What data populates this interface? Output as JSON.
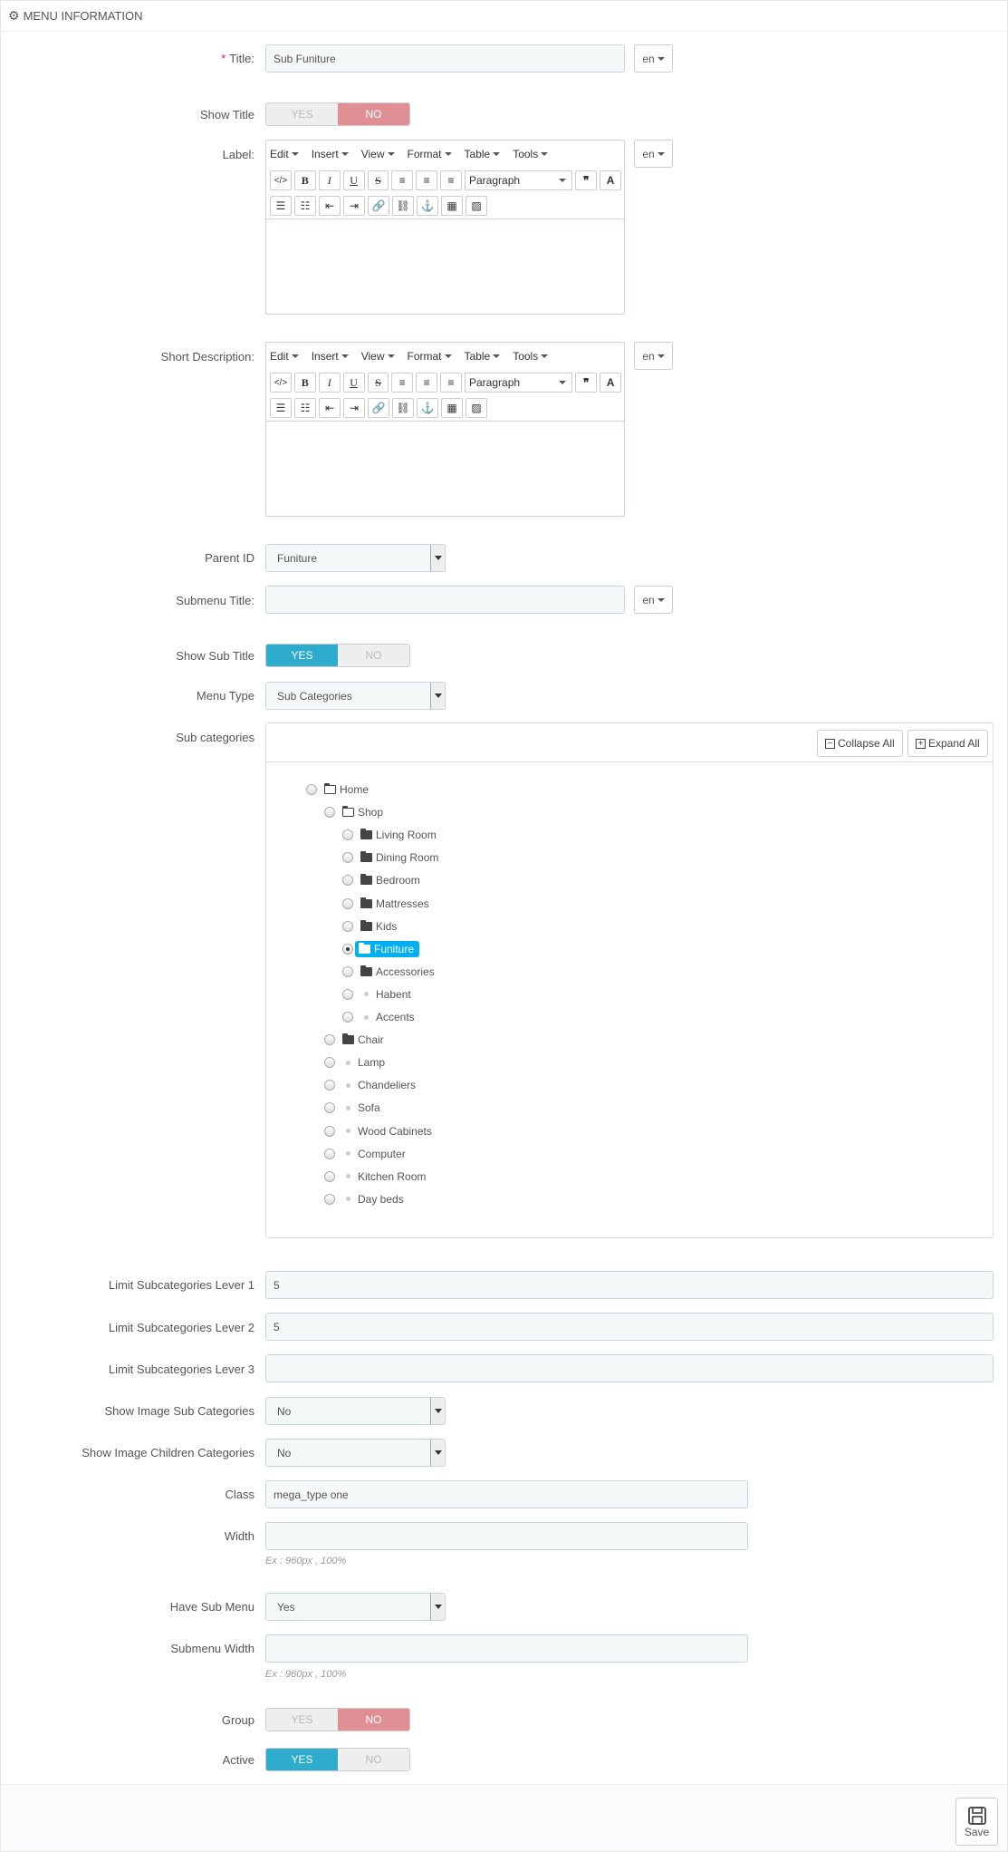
{
  "header": {
    "title": "MENU INFORMATION",
    "icon": "cogs-icon"
  },
  "title_field": {
    "label": "Title:",
    "required_mark": "*",
    "value": "Sub Funiture",
    "lang": "en"
  },
  "show_title": {
    "label": "Show Title",
    "yes": "YES",
    "no": "NO",
    "state": "no"
  },
  "editor_menu": [
    "Edit",
    "Insert",
    "View",
    "Format",
    "Table",
    "Tools"
  ],
  "editor_format_select": "Paragraph",
  "label_field": {
    "label": "Label:",
    "lang": "en"
  },
  "short_description": {
    "label": "Short Description:",
    "lang": "en"
  },
  "parent_id": {
    "label": "Parent ID",
    "value": "Funiture"
  },
  "submenu_title": {
    "label": "Submenu Title:",
    "value": "",
    "lang": "en"
  },
  "show_sub_title": {
    "label": "Show Sub Title",
    "yes": "YES",
    "no": "NO",
    "state": "yes"
  },
  "menu_type": {
    "label": "Menu Type",
    "value": "Sub Categories"
  },
  "sub_categories": {
    "label": "Sub categories",
    "collapse_all": "Collapse All",
    "expand_all": "Expand All",
    "tree": [
      {
        "name": "Home",
        "level": 0,
        "kind": "folder-open",
        "selected": false
      },
      {
        "name": "Shop",
        "level": 1,
        "kind": "folder-open",
        "selected": false
      },
      {
        "name": "Living Room",
        "level": 2,
        "kind": "folder",
        "selected": false
      },
      {
        "name": "Dining Room",
        "level": 2,
        "kind": "folder",
        "selected": false
      },
      {
        "name": "Bedroom",
        "level": 2,
        "kind": "folder",
        "selected": false
      },
      {
        "name": "Mattresses",
        "level": 2,
        "kind": "folder",
        "selected": false
      },
      {
        "name": "Kids",
        "level": 2,
        "kind": "folder",
        "selected": false
      },
      {
        "name": "Funiture",
        "level": 2,
        "kind": "folder",
        "selected": true
      },
      {
        "name": "Accessories",
        "level": 2,
        "kind": "folder",
        "selected": false
      },
      {
        "name": "Habent",
        "level": 2,
        "kind": "leaf",
        "selected": false
      },
      {
        "name": "Accents",
        "level": 2,
        "kind": "leaf",
        "selected": false
      },
      {
        "name": "Chair",
        "level": 1,
        "kind": "folder",
        "selected": false
      },
      {
        "name": "Lamp",
        "level": 1,
        "kind": "leaf",
        "selected": false
      },
      {
        "name": "Chandeliers",
        "level": 1,
        "kind": "leaf",
        "selected": false
      },
      {
        "name": "Sofa",
        "level": 1,
        "kind": "leaf",
        "selected": false
      },
      {
        "name": "Wood Cabinets",
        "level": 1,
        "kind": "leaf",
        "selected": false
      },
      {
        "name": "Computer",
        "level": 1,
        "kind": "leaf",
        "selected": false
      },
      {
        "name": "Kitchen Room",
        "level": 1,
        "kind": "leaf",
        "selected": false
      },
      {
        "name": "Day beds",
        "level": 1,
        "kind": "leaf",
        "selected": false
      }
    ]
  },
  "limit1": {
    "label": "Limit Subcategories Lever 1",
    "value": "5"
  },
  "limit2": {
    "label": "Limit Subcategories Lever 2",
    "value": "5"
  },
  "limit3": {
    "label": "Limit Subcategories Lever 3",
    "value": ""
  },
  "show_image_sub": {
    "label": "Show Image Sub Categories",
    "value": "No"
  },
  "show_image_children": {
    "label": "Show Image Children Categories",
    "value": "No"
  },
  "class_field": {
    "label": "Class",
    "value": "mega_type one"
  },
  "width_field": {
    "label": "Width",
    "value": "",
    "help": "Ex : 960px , 100%"
  },
  "have_sub_menu": {
    "label": "Have Sub Menu",
    "value": "Yes"
  },
  "submenu_width": {
    "label": "Submenu Width",
    "value": "",
    "help": "Ex : 960px , 100%"
  },
  "group": {
    "label": "Group",
    "yes": "YES",
    "no": "NO",
    "state": "no"
  },
  "active": {
    "label": "Active",
    "yes": "YES",
    "no": "NO",
    "state": "yes"
  },
  "footer": {
    "save_label": "Save"
  }
}
